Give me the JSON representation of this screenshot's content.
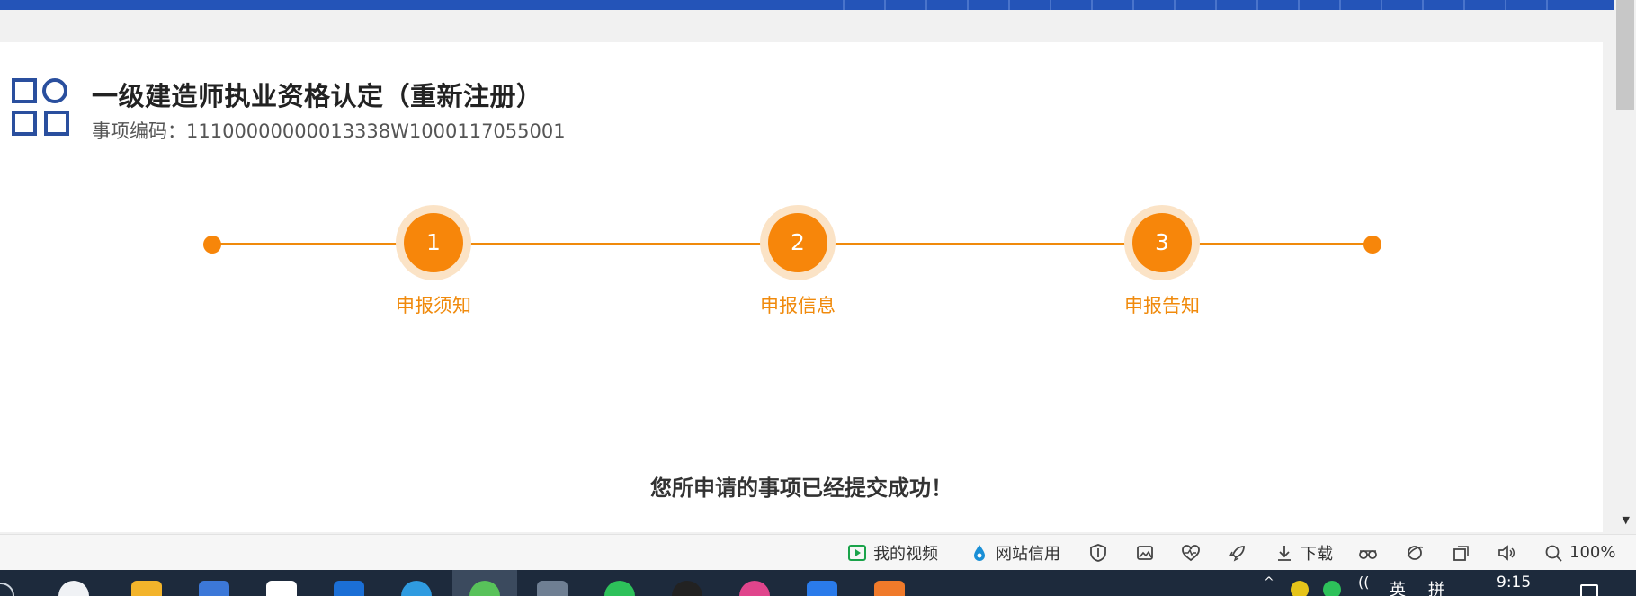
{
  "header": {
    "title": "一级建造师执业资格认定（重新注册）",
    "item_code": "事项编码：11100000000013338W1000117055001"
  },
  "steps": [
    {
      "number": "1",
      "label": "申报须知"
    },
    {
      "number": "2",
      "label": "申报信息"
    },
    {
      "number": "3",
      "label": "申报告知"
    }
  ],
  "message": "您所申请的事项已经提交成功！",
  "statusbar": {
    "my_video": "我的视频",
    "site_credit": "网站信用",
    "download": "下载",
    "zoom": "100%"
  },
  "taskbar": {
    "time": "9:15",
    "ime_lang": "英",
    "ime_mode": "拼"
  },
  "colors": {
    "accent": "#f7860a",
    "brand_blue": "#2454b8",
    "icon_blue": "#2a4f9e"
  },
  "icons": [
    "apps-grid-icon",
    "video-play-icon",
    "water-drop-icon",
    "shield-icon",
    "image-icon",
    "heartbeat-icon",
    "rocket-icon",
    "download-icon",
    "glasses-icon",
    "browser-icon",
    "window-icon",
    "speaker-icon",
    "zoom-icon"
  ]
}
